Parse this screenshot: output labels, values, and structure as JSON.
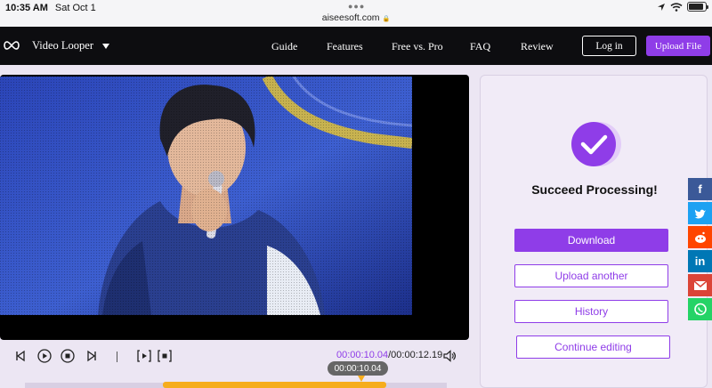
{
  "status": {
    "time": "10:35 AM",
    "date": "Sat Oct 1",
    "url": "aiseesoft.com",
    "battery_percent": 88
  },
  "nav": {
    "brand": "Video Looper",
    "links": [
      "Guide",
      "Features",
      "Free vs. Pro",
      "FAQ",
      "Review"
    ],
    "login": "Log in",
    "upload": "Upload File"
  },
  "player": {
    "current_time": "00:00:10.04",
    "total_time": "/00:00:12.19",
    "tooltip_time": "00:00:10.04"
  },
  "panel": {
    "title": "Succeed Processing!",
    "buttons": {
      "download": "Download",
      "upload_another": "Upload another",
      "history": "History",
      "continue": "Continue editing"
    }
  },
  "share": [
    "facebook",
    "twitter",
    "reddit",
    "linkedin",
    "gmail",
    "whatsapp"
  ],
  "colors": {
    "accent": "#8f3de8",
    "nav_bg": "#0d0d10",
    "page_bg": "#ece6f3",
    "timeline": "#f6ad1d"
  }
}
